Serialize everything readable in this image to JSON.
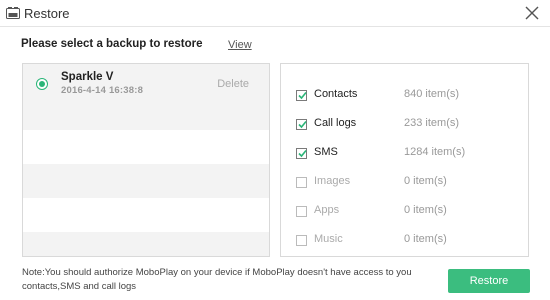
{
  "window": {
    "title": "Restore"
  },
  "header": {
    "prompt": "Please select a backup to restore",
    "view_link": "View"
  },
  "backups": [
    {
      "name": "Sparkle V",
      "date": "2016-4-14 16:38:8",
      "delete_label": "Delete",
      "selected": true
    }
  ],
  "data_types": [
    {
      "label": "Contacts",
      "count": "840 item(s)",
      "checked": true,
      "enabled": true
    },
    {
      "label": "Call logs",
      "count": "233 item(s)",
      "checked": true,
      "enabled": true
    },
    {
      "label": "SMS",
      "count": "1284 item(s)",
      "checked": true,
      "enabled": true
    },
    {
      "label": "Images",
      "count": "0 item(s)",
      "checked": false,
      "enabled": false
    },
    {
      "label": "Apps",
      "count": "0 item(s)",
      "checked": false,
      "enabled": false
    },
    {
      "label": "Music",
      "count": "0 item(s)",
      "checked": false,
      "enabled": false
    }
  ],
  "footer": {
    "note": "Note:You should authorize MoboPlay on your device if MoboPlay doesn't have access to you contacts,SMS and call logs",
    "restore_button": "Restore"
  },
  "colors": {
    "accent": "#3bbd7f",
    "radio": "#2ab578",
    "row_alt": "#f3f3f3",
    "border": "#d9d9d9"
  }
}
